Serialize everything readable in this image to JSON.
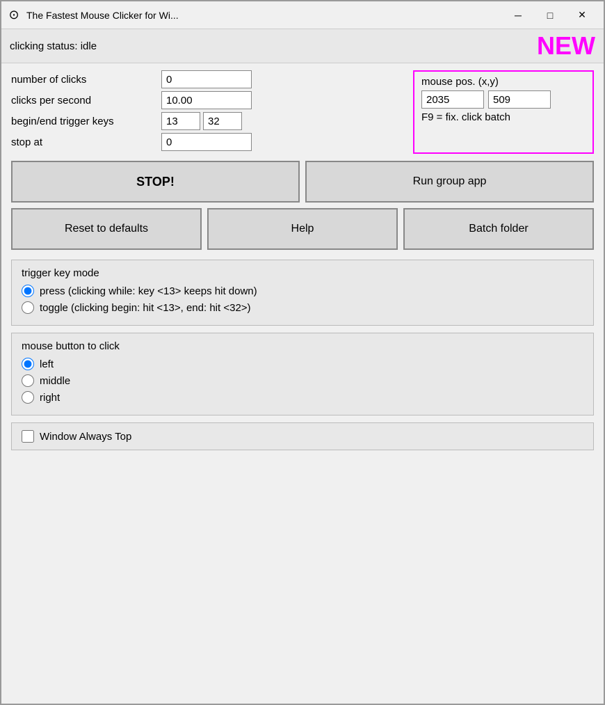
{
  "titlebar": {
    "icon": "⊙",
    "title": "The Fastest Mouse Clicker for Wi...",
    "minimize_label": "─",
    "maximize_label": "□",
    "close_label": "✕"
  },
  "status": {
    "text": "clicking status: idle",
    "new_badge": "NEW"
  },
  "fields": {
    "num_clicks_label": "number of clicks",
    "num_clicks_value": "0",
    "clicks_per_sec_label": "clicks per second",
    "clicks_per_sec_value": "10.00",
    "trigger_keys_label": "begin/end trigger keys",
    "trigger_key1": "13",
    "trigger_key2": "32",
    "stop_at_label": "stop at",
    "stop_at_value": "0"
  },
  "mouse_pos": {
    "label": "mouse pos. (x,y)",
    "x_value": "2035",
    "y_value": "509",
    "hint": "F9 = fix. click batch"
  },
  "buttons": {
    "stop_label": "STOP!",
    "run_group_label": "Run group app",
    "reset_label": "Reset to defaults",
    "help_label": "Help",
    "batch_folder_label": "Batch folder"
  },
  "trigger_key_mode": {
    "title": "trigger key mode",
    "press_label": "press (clicking while: key <13> keeps hit down)",
    "toggle_label": "toggle (clicking begin: hit <13>, end: hit <32>)"
  },
  "mouse_button": {
    "title": "mouse button to click",
    "left_label": "left",
    "middle_label": "middle",
    "right_label": "right"
  },
  "window_top": {
    "label": "Window Always Top"
  }
}
